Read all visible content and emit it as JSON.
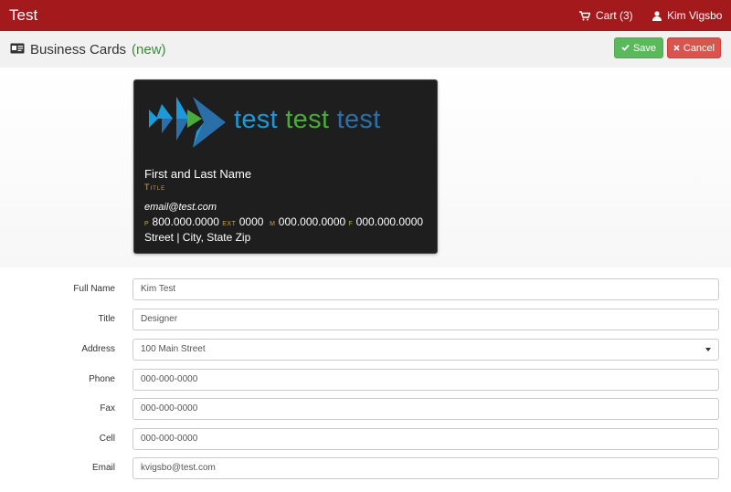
{
  "app": {
    "title": "Test"
  },
  "nav": {
    "cart_label": "Cart (3)",
    "user_name": "Kim Vigsbo"
  },
  "header": {
    "title": "Business Cards",
    "new_tag": "(new)",
    "save_label": "Save",
    "cancel_label": "Cancel"
  },
  "card": {
    "company_words": [
      "test",
      "test",
      "test"
    ],
    "name": "First and Last Name",
    "title": "Title",
    "email": "email@test.com",
    "phone_label": "P",
    "phone": "800.000.0000",
    "ext_label": "EXT",
    "ext": "0000",
    "mobile_label": "M",
    "mobile": "000.000.0000",
    "fax_label": "F",
    "fax": "000.000.0000",
    "address": "Street | City, State  Zip"
  },
  "form": {
    "fields": [
      {
        "label": "Full Name",
        "value": "Kim Test"
      },
      {
        "label": "Title",
        "value": "Designer"
      },
      {
        "label": "Address",
        "value": "100 Main Street"
      },
      {
        "label": "Phone",
        "value": "000-000-0000"
      },
      {
        "label": "Fax",
        "value": "000-000-0000"
      },
      {
        "label": "Cell",
        "value": "000-000-0000"
      },
      {
        "label": "Email",
        "value": "kvigsbo@test.com"
      }
    ]
  },
  "colors": {
    "topbar": "#a3191c",
    "save": "#5cb85c",
    "cancel": "#d9534f",
    "new_tag": "#3a8a3a",
    "card_bg": "#1e1e1e",
    "card_accent": "#c8a64b"
  },
  "icons": {
    "cart": "cart-icon",
    "user": "user-icon",
    "page": "id-card-icon",
    "save": "check-icon",
    "cancel": "close-icon",
    "select": "caret-down-icon"
  }
}
